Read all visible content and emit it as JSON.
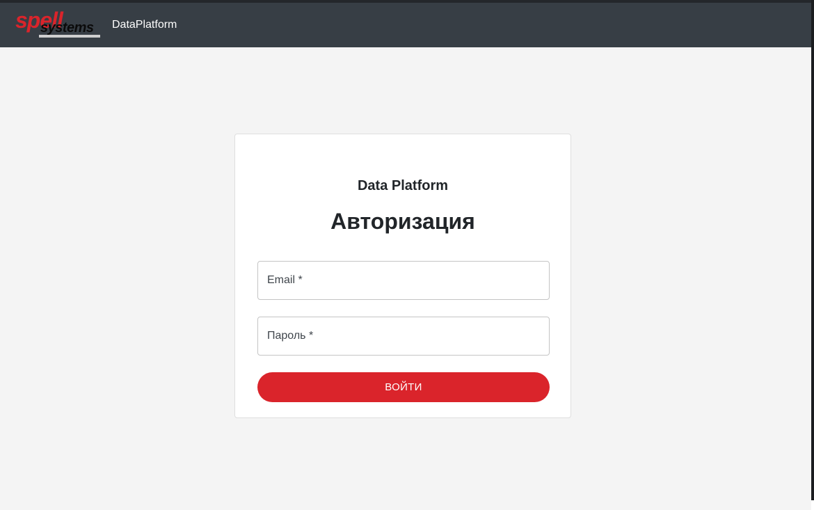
{
  "appbar": {
    "logo_top": "spell",
    "logo_bottom": "systems",
    "title": "DataPlatform"
  },
  "login": {
    "subtitle": "Data Platform",
    "title": "Авторизация",
    "email_placeholder": "Email *",
    "password_placeholder": "Пароль *",
    "submit_label": "ВОЙТИ"
  },
  "colors": {
    "appbar": "#373e45",
    "background": "#f4f4f4",
    "accent": "#da242b",
    "text": "#212529"
  }
}
